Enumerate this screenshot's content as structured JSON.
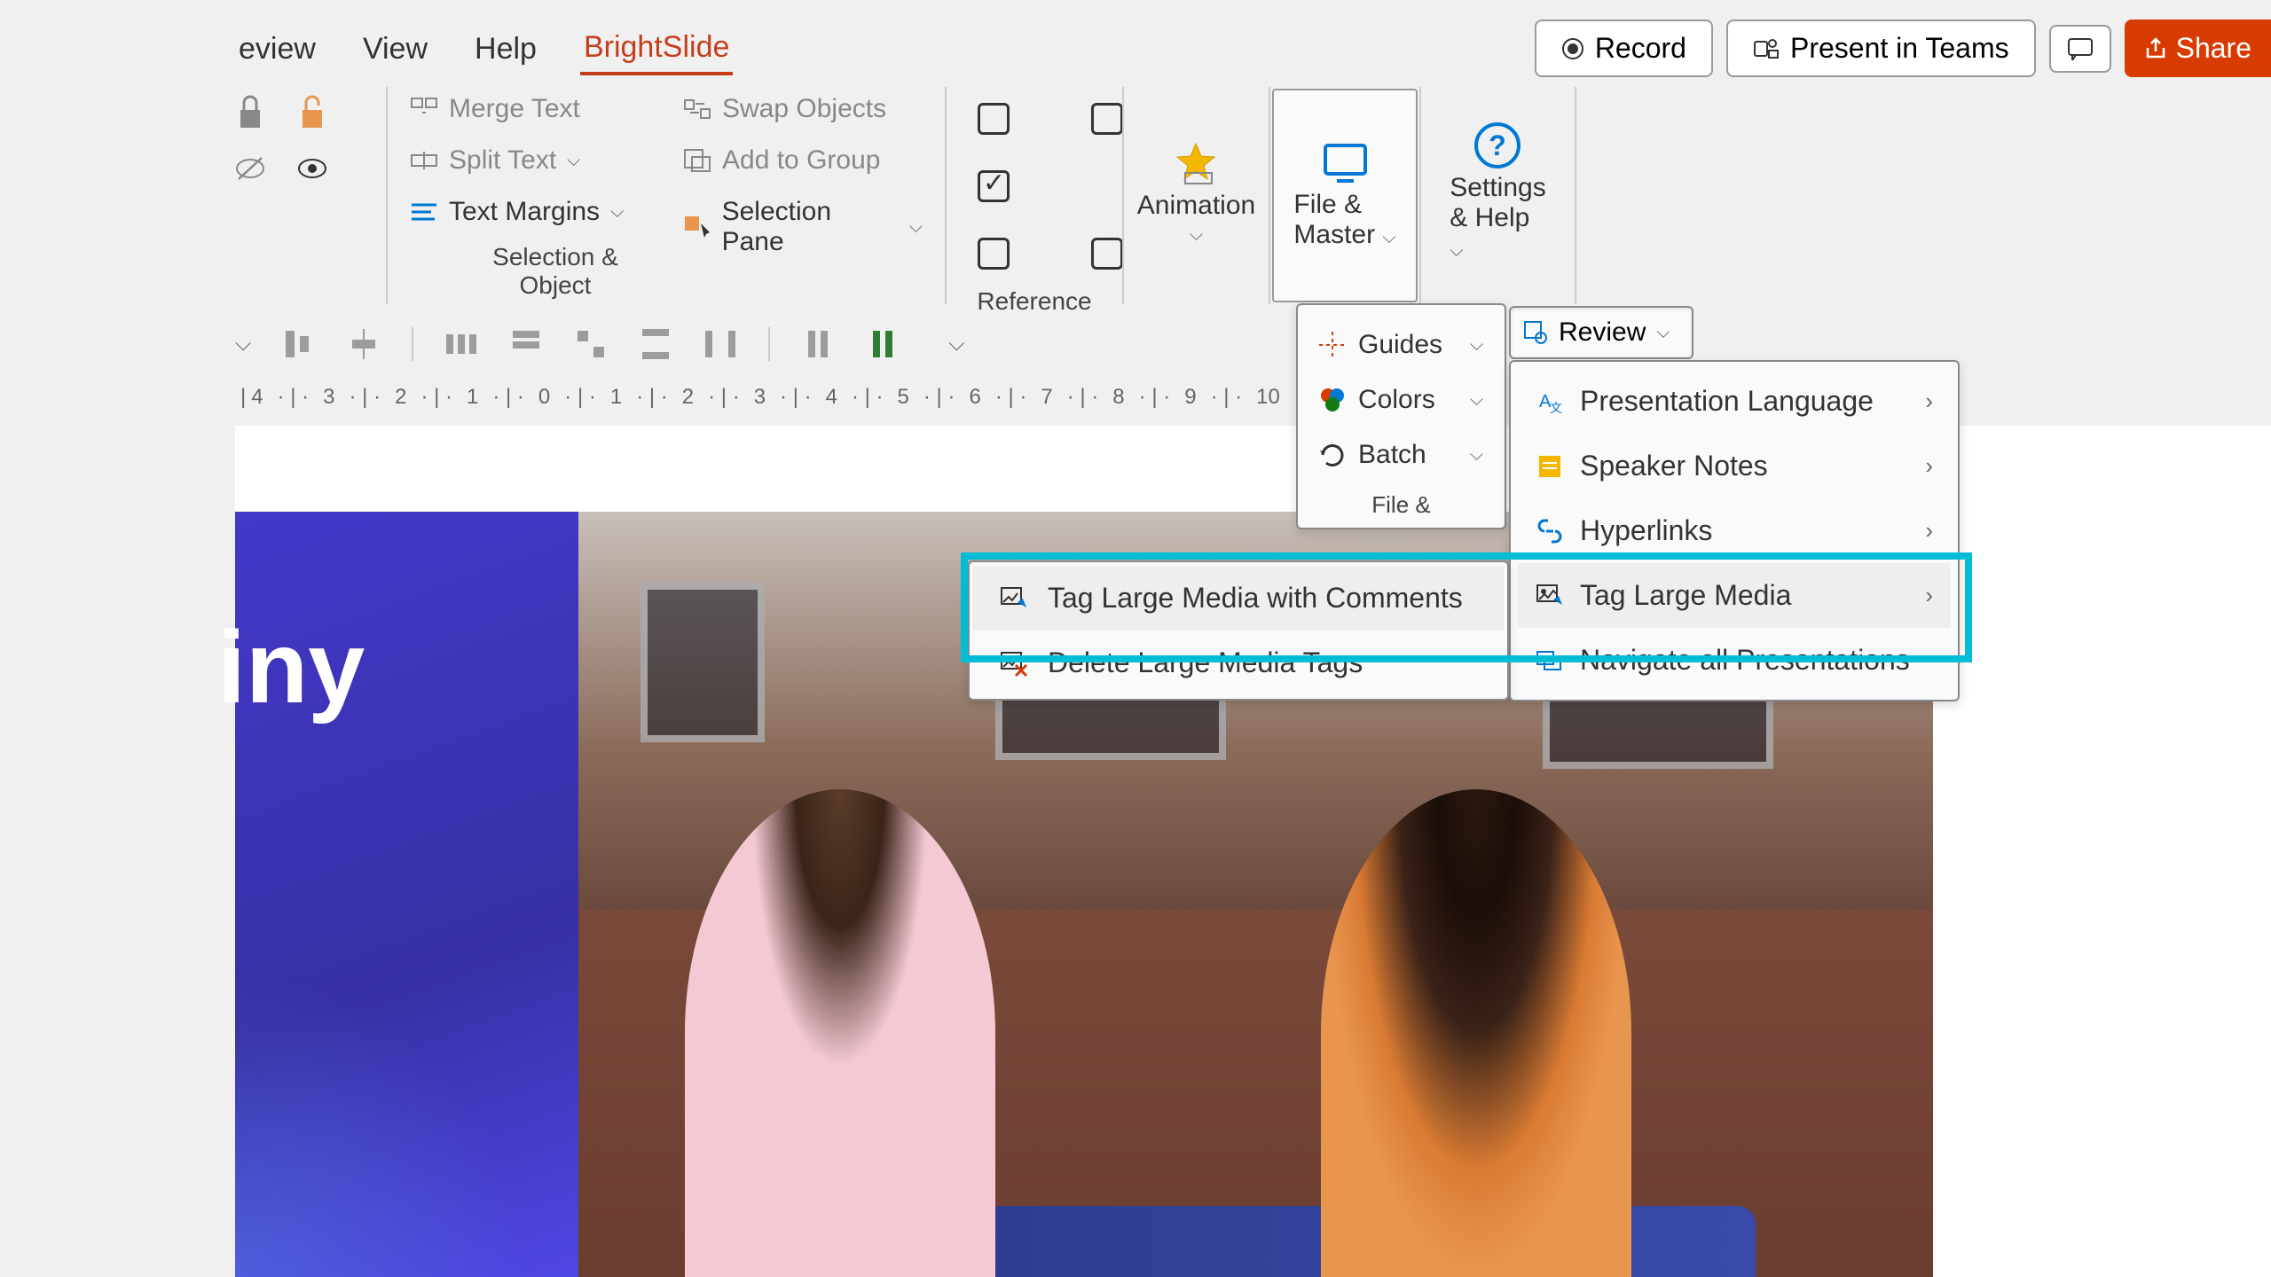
{
  "tabs": [
    "eview",
    "View",
    "Help",
    "BrightSlide"
  ],
  "active_tab": "BrightSlide",
  "top_buttons": {
    "record": "Record",
    "present": "Present in Teams",
    "share": "Share"
  },
  "ribbon": {
    "merge_text": "Merge Text",
    "split_text": "Split Text",
    "text_margins": "Text Margins",
    "swap_objects": "Swap Objects",
    "add_to_group": "Add to Group",
    "selection_pane": "Selection Pane",
    "group1_label": "Selection & Object",
    "group2_label": "Reference",
    "animation": "Animation",
    "file_master": "File & Master",
    "settings_help": "Settings & Help"
  },
  "file_master_panel": {
    "guides": "Guides",
    "colors": "Colors",
    "batch": "Batch",
    "review": "Review",
    "label": "File & "
  },
  "review_menu": {
    "presentation_language": "Presentation Language",
    "speaker_notes": "Speaker Notes",
    "hyperlinks": "Hyperlinks",
    "tag_large_media": "Tag Large Media",
    "navigate_all": "Navigate all Presentations"
  },
  "submenu": {
    "tag_comments": "Tag Large Media with Comments",
    "delete_tags": "Delete Large Media Tags"
  },
  "ruler_marks": [
    "4",
    "3",
    "2",
    "1",
    "0",
    "1",
    "2",
    "3",
    "4",
    "5",
    "6",
    "7",
    "8",
    "9",
    "10"
  ],
  "slide_text": "iny"
}
